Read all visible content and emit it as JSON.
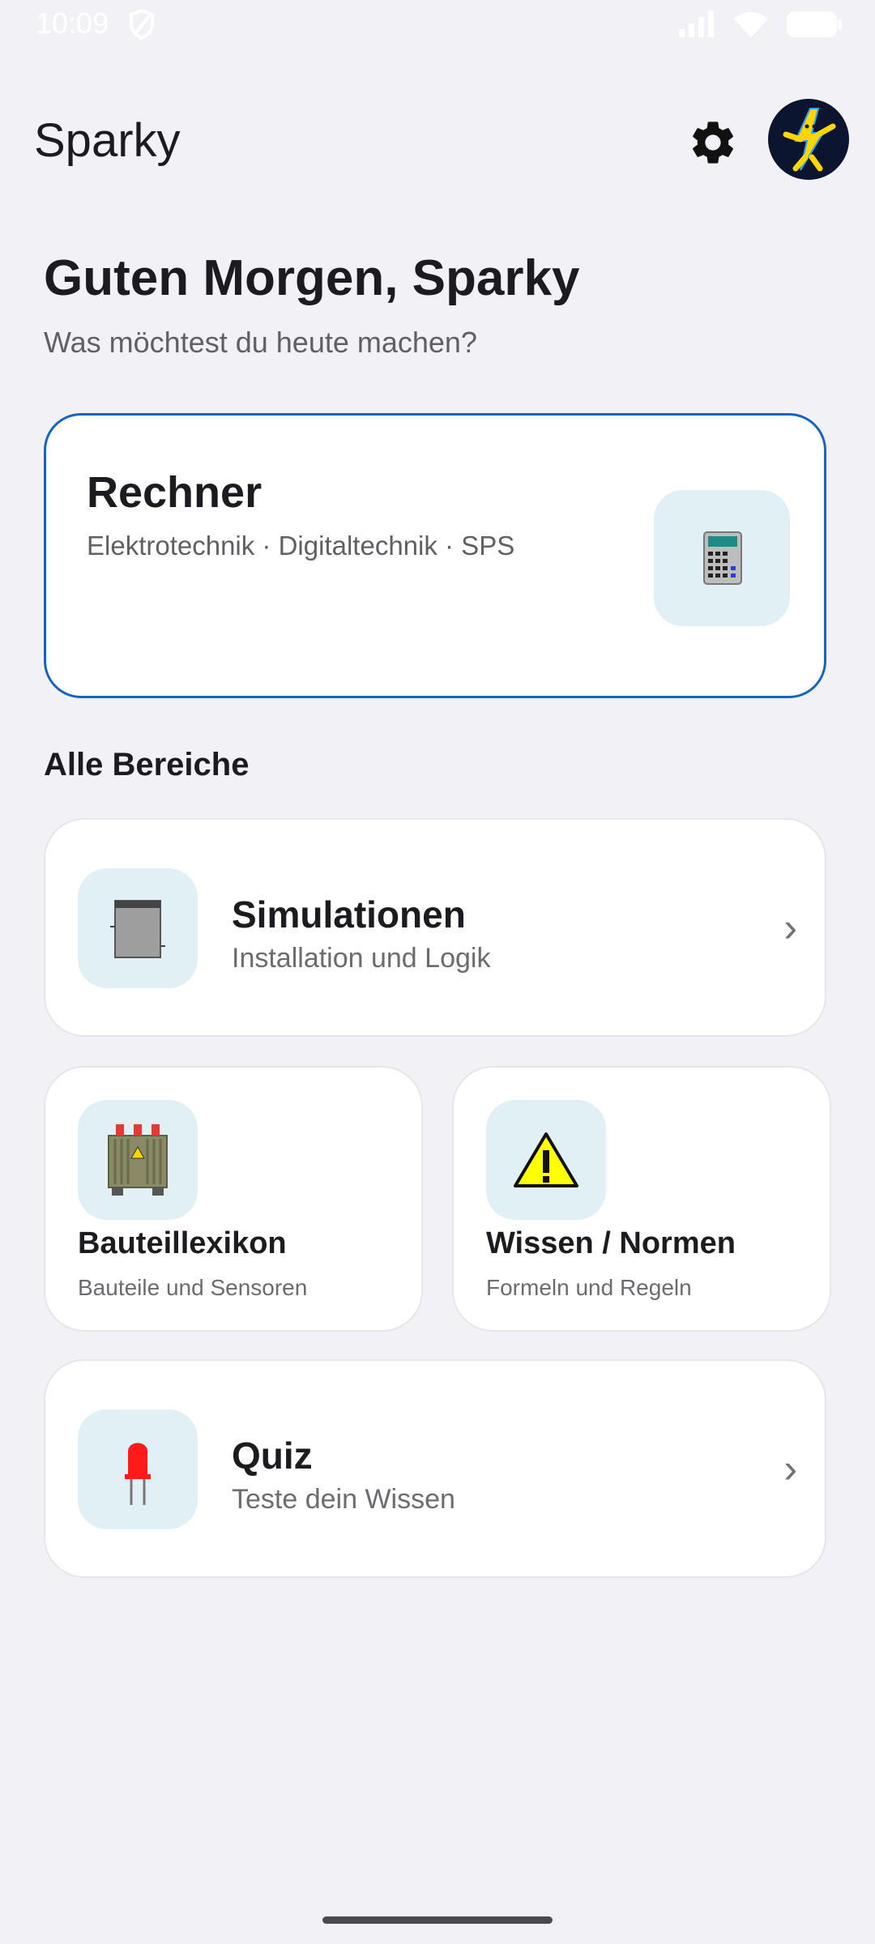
{
  "status_bar": {
    "time": "10:09"
  },
  "app_bar": {
    "title": "Sparky"
  },
  "greeting": {
    "title": "Guten Morgen, Sparky",
    "subtitle": "Was möchtest du heute machen?"
  },
  "featured": {
    "title": "Rechner",
    "subtitle": "Elektrotechnik · Digitaltechnik · SPS",
    "icon": "calculator-icon"
  },
  "section_title": "Alle Bereiche",
  "cards": {
    "simulationen": {
      "title": "Simulationen",
      "subtitle": "Installation und Logik",
      "icon": "switch-cabinet-icon"
    },
    "bauteillexikon": {
      "title": "Bauteillexikon",
      "subtitle": "Bauteile und Sensoren",
      "icon": "transformer-icon"
    },
    "wissen": {
      "title": "Wissen / Normen",
      "subtitle": "Formeln und Regeln",
      "icon": "warning-icon"
    },
    "quiz": {
      "title": "Quiz",
      "subtitle": "Teste dein Wissen",
      "icon": "led-icon"
    }
  },
  "colors": {
    "accent": "#1565c0",
    "background": "#f2f2f6",
    "icon_tile": "#e1f0f4"
  }
}
